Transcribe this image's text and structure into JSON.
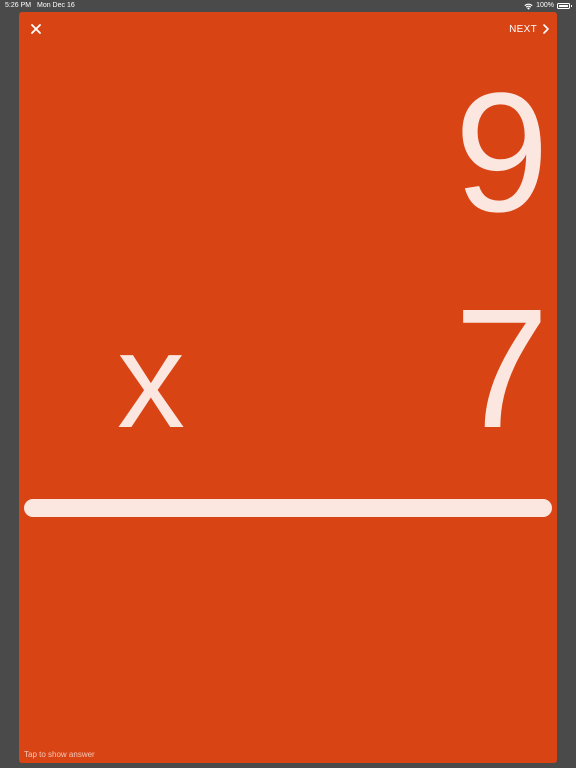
{
  "status_bar": {
    "time": "5:26 PM",
    "date": "Mon Dec 16",
    "battery": "100%"
  },
  "toolbar": {
    "close_icon": "close-icon",
    "next_label": "NEXT",
    "next_icon": "chevron-right-icon"
  },
  "problem": {
    "operand_top": "9",
    "operator": "x",
    "operand_bottom": "7"
  },
  "hint": "Tap to show answer",
  "colors": {
    "card": "#d94415",
    "text": "#fbe6e0",
    "background": "#4a4a4a"
  }
}
